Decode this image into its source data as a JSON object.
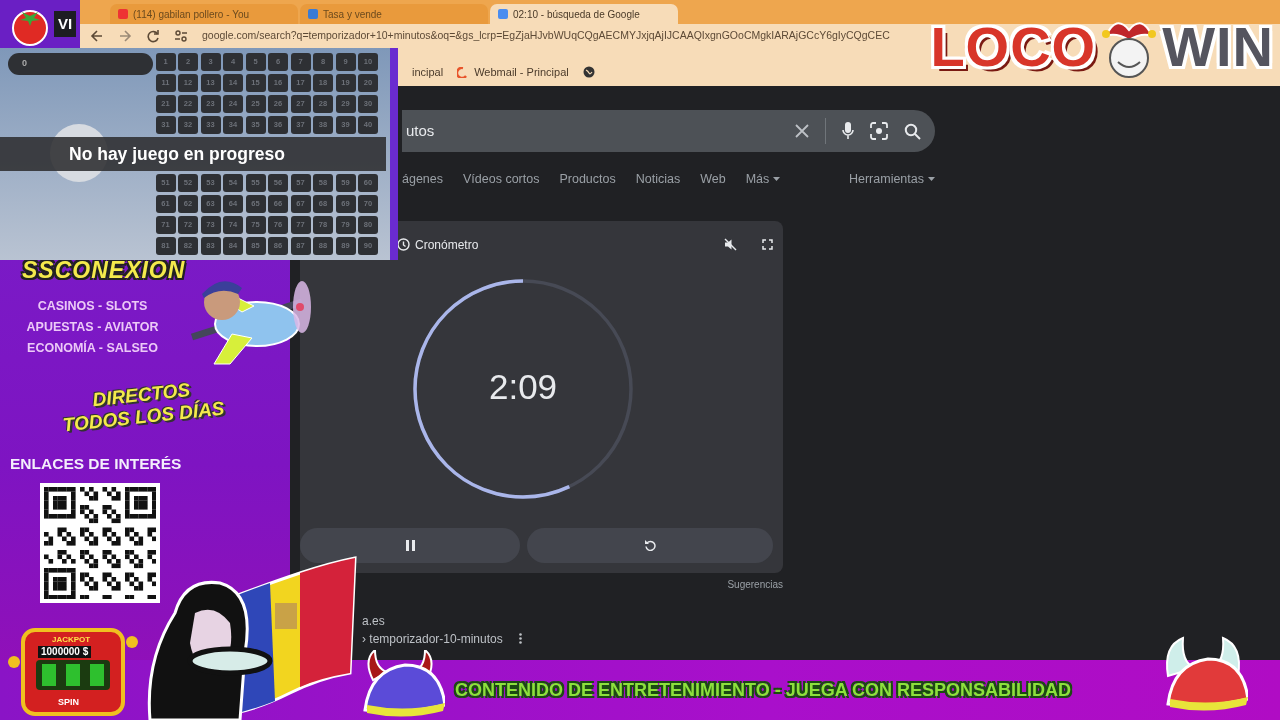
{
  "browser": {
    "tabs": [
      {
        "title": "(114) gabilan pollero - You",
        "selected": false
      },
      {
        "title": "Tasa y vende",
        "selected": false
      },
      {
        "title": "02:10 - búsqueda de Google",
        "selected": true
      }
    ],
    "address": "google.com/search?q=temporizador+10+minutos&oq=&gs_lcrp=EgZjaHJvbWUqCQgAECMYJxjqAjIJCAAQIxgnGOoCMgkIARAjGCcY6gIyCQgCEC",
    "bookmarks": [
      "incipal",
      "Webmail - Principal"
    ]
  },
  "search": {
    "query": "utos",
    "filters": [
      {
        "label": "ágenes",
        "selected": false
      },
      {
        "label": "Vídeos cortos",
        "selected": false
      },
      {
        "label": "Productos",
        "selected": false
      },
      {
        "label": "Noticias",
        "selected": false
      },
      {
        "label": "Web",
        "selected": false
      }
    ],
    "more": "Más",
    "tools": "Herramientas"
  },
  "timer_card": {
    "title": "Cronómetro",
    "time": "2:09",
    "level": 0.57,
    "suggestions": "Sugerencias"
  },
  "result": {
    "site": "a.es",
    "path": "› temporizador-10-minutos"
  },
  "bingo": {
    "counter": "0",
    "message": "No hay juego en progreso",
    "numbers": [
      "1",
      "2",
      "3",
      "4",
      "5",
      "6",
      "7",
      "8",
      "9",
      "10",
      "11",
      "12",
      "13",
      "14",
      "15",
      "16",
      "17",
      "18",
      "19",
      "20",
      "21",
      "22",
      "23",
      "24",
      "25",
      "26",
      "27",
      "28",
      "29",
      "30",
      "31",
      "32",
      "33",
      "34",
      "35",
      "36",
      "37",
      "38",
      "39",
      "40",
      "51",
      "52",
      "53",
      "54",
      "55",
      "56",
      "57",
      "58",
      "59",
      "60",
      "61",
      "62",
      "63",
      "64",
      "65",
      "66",
      "67",
      "68",
      "69",
      "70",
      "71",
      "72",
      "73",
      "74",
      "75",
      "76",
      "77",
      "78",
      "79",
      "80",
      "81",
      "82",
      "83",
      "84",
      "85",
      "86",
      "87",
      "88",
      "89",
      "90"
    ]
  },
  "sidebar": {
    "tomato_label": "VI",
    "brand": "SSCONEXION",
    "topics": [
      "CASINOS - SLOTS",
      "APUESTAS - AVIATOR",
      "ECONOMÍA - SALSEO"
    ],
    "slogan": [
      "DIRECTOS",
      "TODOS LOS DÍAS"
    ],
    "links_heading": "ENLACES DE INTERÉS"
  },
  "jackpot": {
    "title": "JACKPOT",
    "amount": "1000000 $",
    "button": "SPIN"
  },
  "logo": {
    "words": [
      "LOCO",
      "WIN"
    ]
  },
  "banner": {
    "text": "CONTENIDO DE ENTRETENIMIENTO - JUEGA CON RESPONSABILIDAD"
  }
}
